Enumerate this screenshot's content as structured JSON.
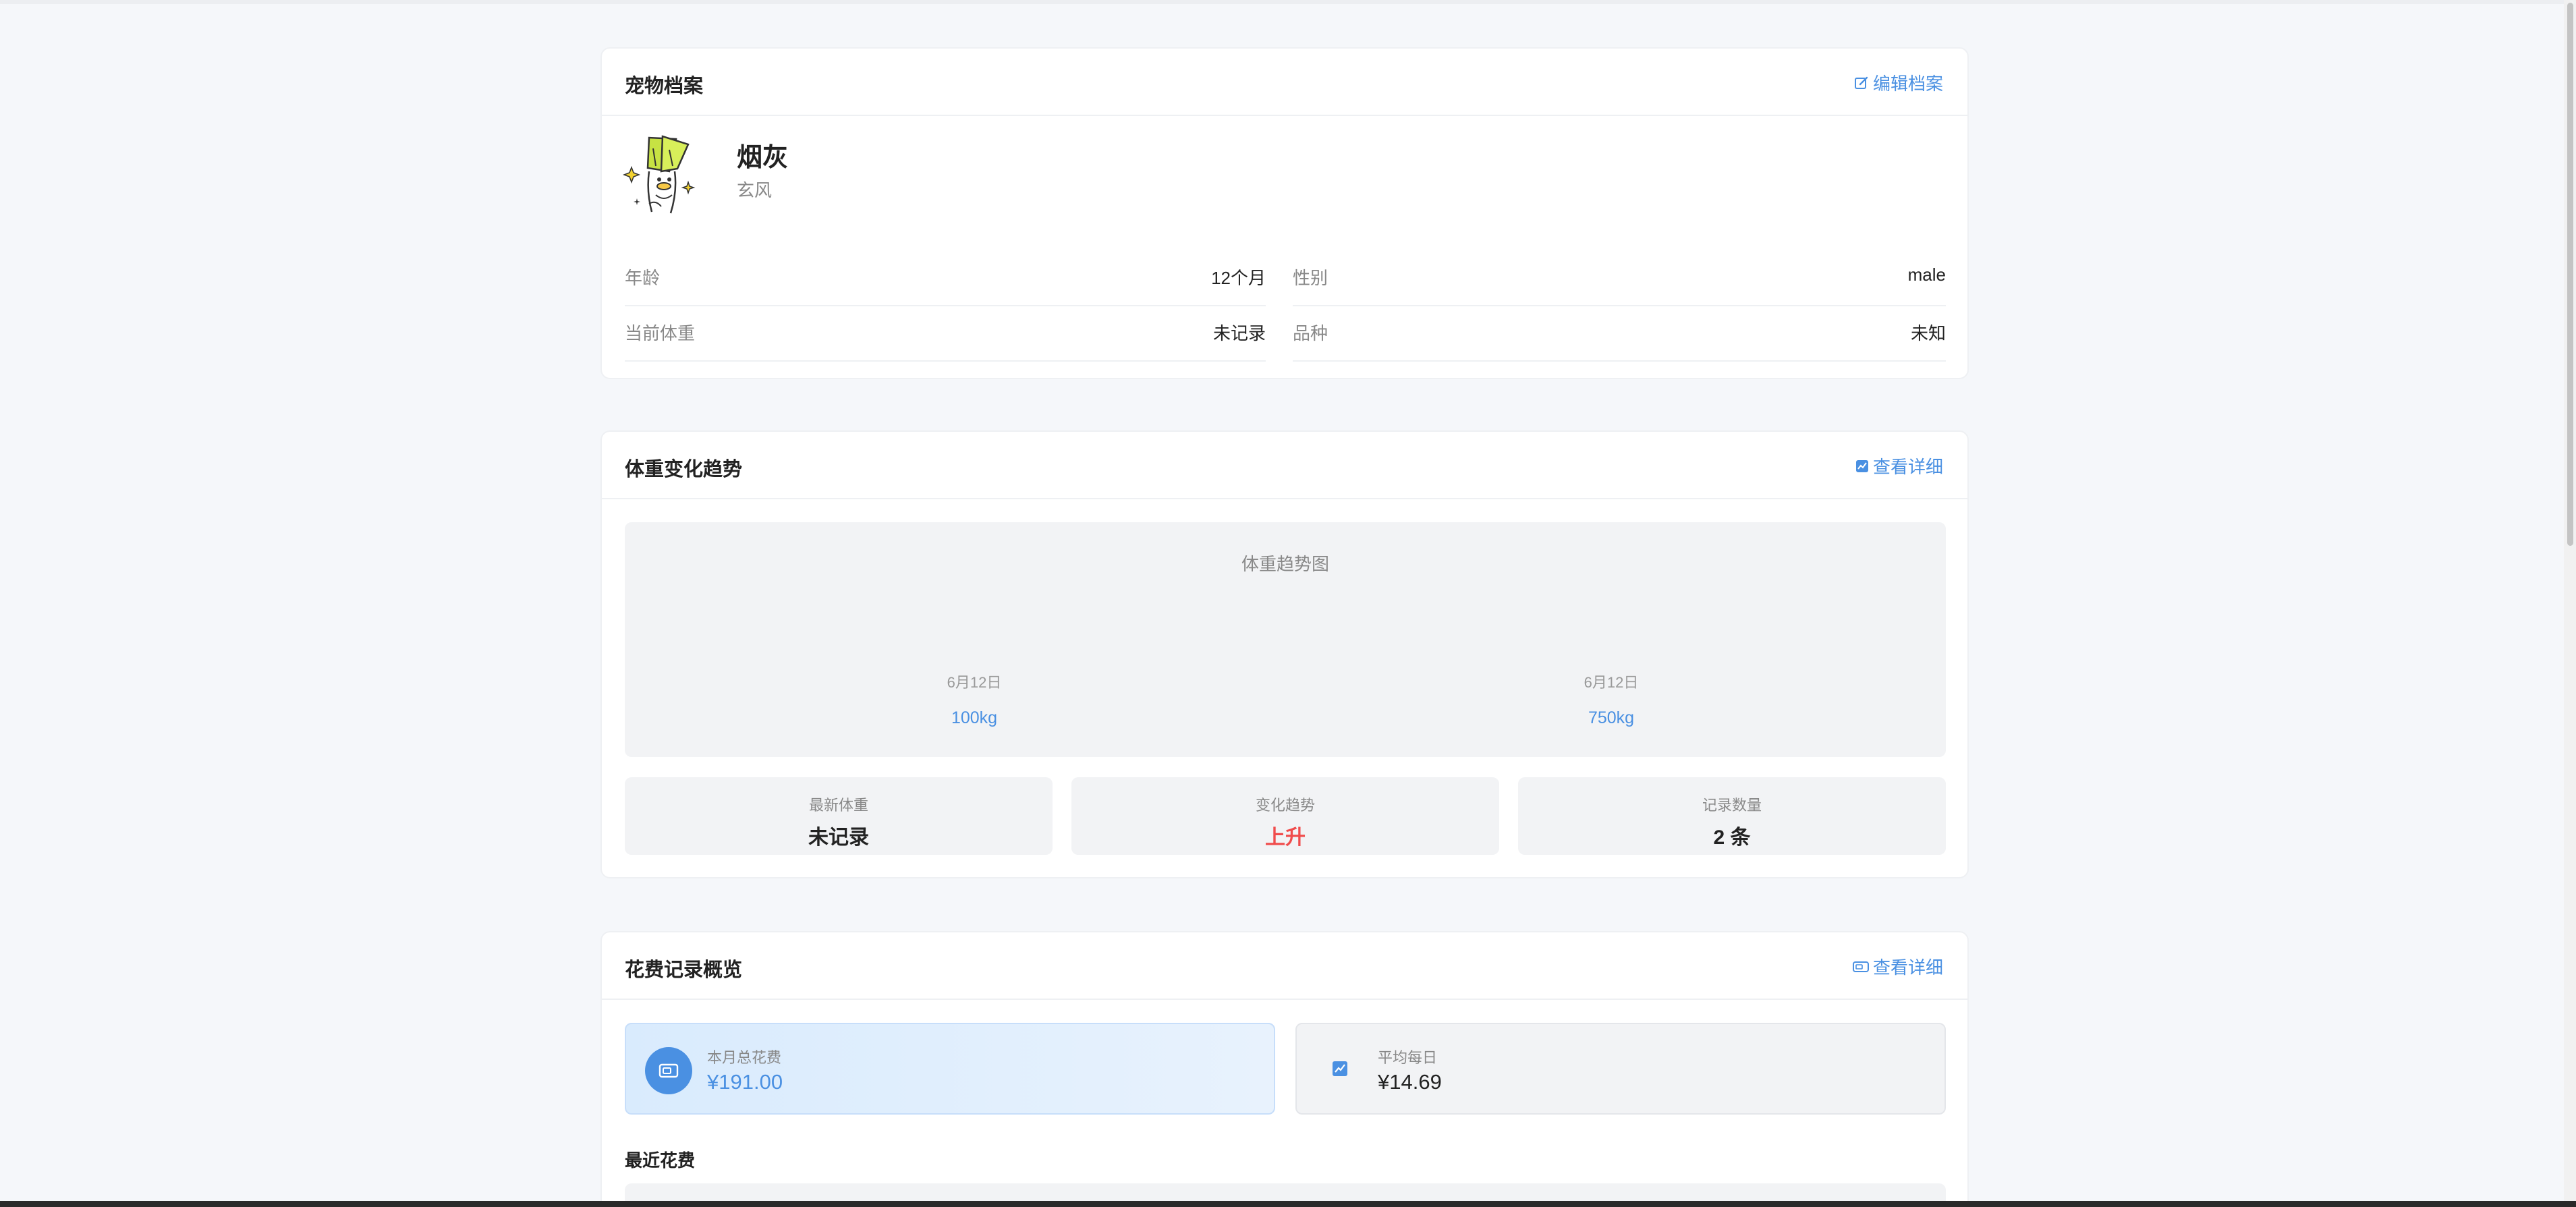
{
  "profile": {
    "title": "宠物档案",
    "edit_label": "编辑档案",
    "name": "烟灰",
    "breed_sub": "玄风",
    "rows": [
      {
        "label": "年龄",
        "value": "12个月"
      },
      {
        "label": "性别",
        "value": "male"
      },
      {
        "label": "当前体重",
        "value": "未记录"
      },
      {
        "label": "品种",
        "value": "未知"
      }
    ]
  },
  "weight": {
    "title": "体重变化趋势",
    "detail_label": "查看详细",
    "chart_title": "体重趋势图",
    "points": [
      {
        "date": "6月12日",
        "value": "100kg"
      },
      {
        "date": "6月12日",
        "value": "750kg"
      }
    ],
    "stats": [
      {
        "label": "最新体重",
        "value": "未记录"
      },
      {
        "label": "变化趋势",
        "value": "上升"
      },
      {
        "label": "记录数量",
        "value": "2 条"
      }
    ]
  },
  "expense": {
    "title": "花费记录概览",
    "detail_label": "查看详细",
    "monthly_label": "本月总花费",
    "monthly_value": "¥191.00",
    "daily_label": "平均每日",
    "daily_value": "¥14.69",
    "recent_title": "最近花费"
  },
  "colors": {
    "accent": "#4a90e2",
    "trend_up": "#f04c4c",
    "background": "#f5f7fa"
  },
  "icons": {
    "edit": "edit-icon",
    "chart": "chart-icon",
    "money": "money-icon",
    "trend": "trend-icon"
  }
}
